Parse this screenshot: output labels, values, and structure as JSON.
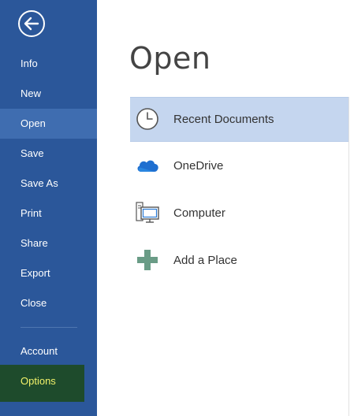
{
  "sidebar": {
    "back_icon": "back-arrow-icon",
    "items": [
      {
        "label": "Info"
      },
      {
        "label": "New"
      },
      {
        "label": "Open",
        "selected": true
      },
      {
        "label": "Save"
      },
      {
        "label": "Save As"
      },
      {
        "label": "Print"
      },
      {
        "label": "Share"
      },
      {
        "label": "Export"
      },
      {
        "label": "Close"
      }
    ],
    "bottom_items": [
      {
        "label": "Account"
      },
      {
        "label": "Options",
        "highlighted": true
      }
    ]
  },
  "main": {
    "title": "Open",
    "places": [
      {
        "label": "Recent Documents",
        "icon": "clock-icon",
        "selected": true
      },
      {
        "label": "OneDrive",
        "icon": "cloud-icon"
      },
      {
        "label": "Computer",
        "icon": "computer-icon"
      },
      {
        "label": "Add a Place",
        "icon": "plus-icon"
      }
    ]
  },
  "colors": {
    "sidebar_bg": "#2b579a",
    "sidebar_selected": "#3f6db0",
    "options_bg": "#1e4b2c",
    "options_text": "#f2f26a",
    "place_selected": "#c5d6ef"
  }
}
